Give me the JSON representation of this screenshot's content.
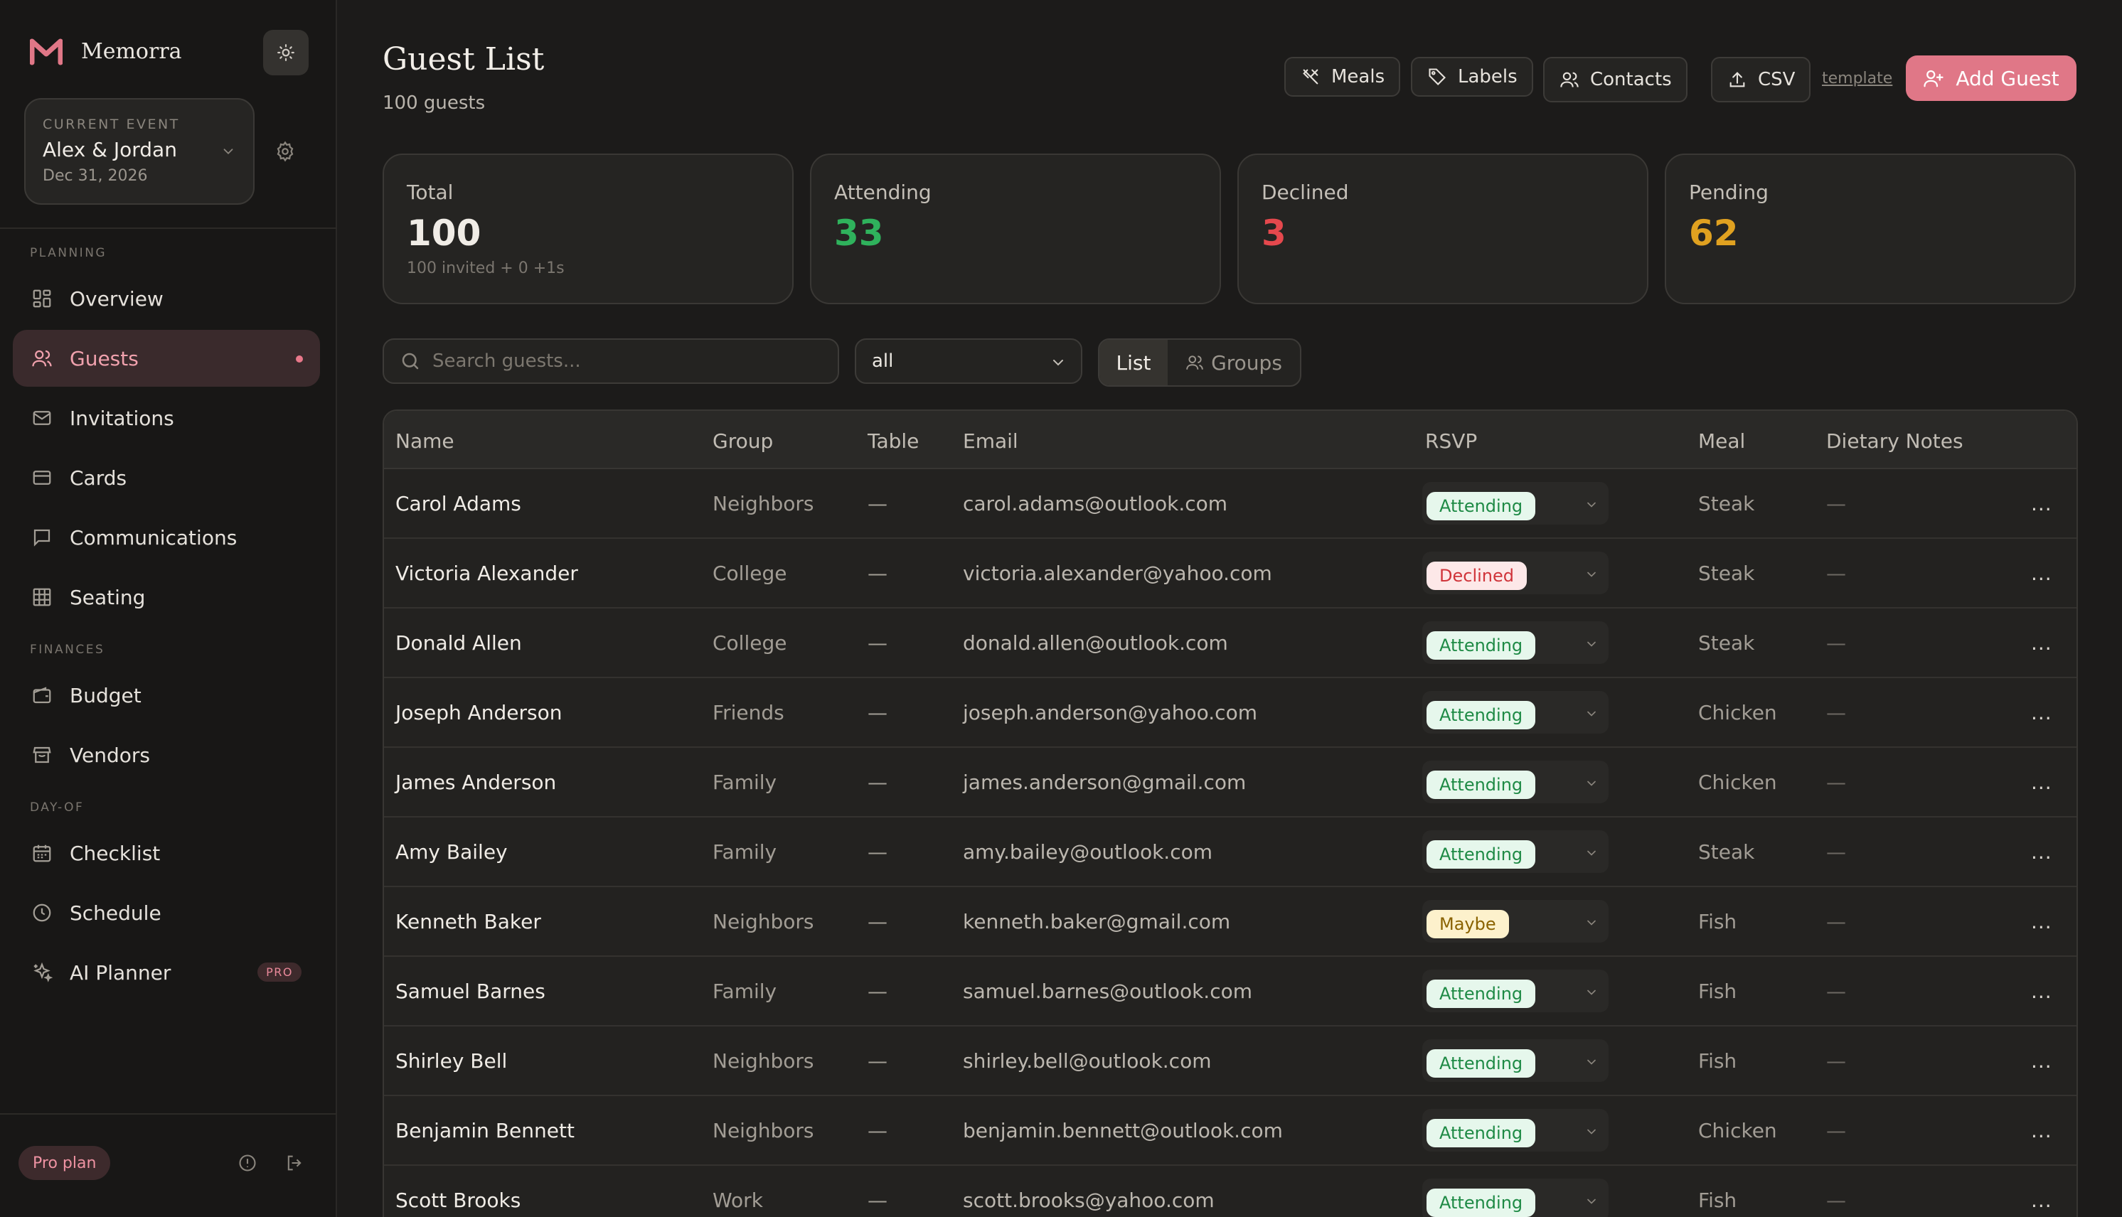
{
  "brand": {
    "name": "Memorra"
  },
  "event": {
    "label": "CURRENT EVENT",
    "name": "Alex & Jordan",
    "date": "Dec 31, 2026"
  },
  "sidebar": {
    "sections": {
      "planning": "PLANNING",
      "finances": "FINANCES",
      "dayof": "DAY-OF"
    },
    "items": [
      {
        "label": "Overview",
        "icon": "grid-icon"
      },
      {
        "label": "Guests",
        "icon": "users-icon"
      },
      {
        "label": "Invitations",
        "icon": "mail-icon"
      },
      {
        "label": "Cards",
        "icon": "card-icon"
      },
      {
        "label": "Communications",
        "icon": "message-icon"
      },
      {
        "label": "Seating",
        "icon": "table-icon"
      },
      {
        "label": "Budget",
        "icon": "wallet-icon"
      },
      {
        "label": "Vendors",
        "icon": "store-icon"
      },
      {
        "label": "Checklist",
        "icon": "calendar-icon"
      },
      {
        "label": "Schedule",
        "icon": "clock-icon"
      },
      {
        "label": "AI Planner",
        "icon": "sparkle-icon",
        "badge": "PRO"
      }
    ],
    "plan": "Pro plan"
  },
  "header": {
    "title": "Guest List",
    "subtitle": "100 guests",
    "buttons": {
      "meals": "Meals",
      "labels": "Labels",
      "contacts": "Contacts",
      "csv": "CSV",
      "template": "template",
      "add": "Add Guest"
    }
  },
  "stats": [
    {
      "label": "Total",
      "value": "100",
      "sub": "100 invited + 0 +1s",
      "color": "#f0ece6"
    },
    {
      "label": "Attending",
      "value": "33",
      "color": "#2fb25c"
    },
    {
      "label": "Declined",
      "value": "3",
      "color": "#e5484d"
    },
    {
      "label": "Pending",
      "value": "62",
      "color": "#e0a120"
    }
  ],
  "filters": {
    "search_placeholder": "Search guests...",
    "rsvp_filter": "all",
    "view": {
      "list": "List",
      "groups": "Groups"
    }
  },
  "table": {
    "columns": [
      "Name",
      "Group",
      "Table",
      "Email",
      "RSVP",
      "Meal",
      "Dietary Notes"
    ],
    "rows": [
      {
        "name": "Carol Adams",
        "group": "Neighbors",
        "table": "—",
        "email": "carol.adams@outlook.com",
        "rsvp": "Attending",
        "meal": "Steak",
        "diet": "—"
      },
      {
        "name": "Victoria Alexander",
        "group": "College",
        "table": "—",
        "email": "victoria.alexander@yahoo.com",
        "rsvp": "Declined",
        "meal": "Steak",
        "diet": "—"
      },
      {
        "name": "Donald Allen",
        "group": "College",
        "table": "—",
        "email": "donald.allen@outlook.com",
        "rsvp": "Attending",
        "meal": "Steak",
        "diet": "—"
      },
      {
        "name": "Joseph Anderson",
        "group": "Friends",
        "table": "—",
        "email": "joseph.anderson@yahoo.com",
        "rsvp": "Attending",
        "meal": "Chicken",
        "diet": "—"
      },
      {
        "name": "James Anderson",
        "group": "Family",
        "table": "—",
        "email": "james.anderson@gmail.com",
        "rsvp": "Attending",
        "meal": "Chicken",
        "diet": "—"
      },
      {
        "name": "Amy Bailey",
        "group": "Family",
        "table": "—",
        "email": "amy.bailey@outlook.com",
        "rsvp": "Attending",
        "meal": "Steak",
        "diet": "—"
      },
      {
        "name": "Kenneth Baker",
        "group": "Neighbors",
        "table": "—",
        "email": "kenneth.baker@gmail.com",
        "rsvp": "Maybe",
        "meal": "Fish",
        "diet": "—"
      },
      {
        "name": "Samuel Barnes",
        "group": "Family",
        "table": "—",
        "email": "samuel.barnes@outlook.com",
        "rsvp": "Attending",
        "meal": "Fish",
        "diet": "—"
      },
      {
        "name": "Shirley Bell",
        "group": "Neighbors",
        "table": "—",
        "email": "shirley.bell@outlook.com",
        "rsvp": "Attending",
        "meal": "Fish",
        "diet": "—"
      },
      {
        "name": "Benjamin Bennett",
        "group": "Neighbors",
        "table": "—",
        "email": "benjamin.bennett@outlook.com",
        "rsvp": "Attending",
        "meal": "Chicken",
        "diet": "—"
      },
      {
        "name": "Scott Brooks",
        "group": "Work",
        "table": "—",
        "email": "scott.brooks@yahoo.com",
        "rsvp": "Attending",
        "meal": "Fish",
        "diet": "—"
      }
    ],
    "row_menu": "···"
  },
  "colors": {
    "accent": "#e07787",
    "attending_bg": "#e6f7ec",
    "attending_fg": "#1e8a45",
    "declined_bg": "#fde8e8",
    "declined_fg": "#d0343a",
    "maybe_bg": "#fdf1cc",
    "maybe_fg": "#8a6200"
  }
}
